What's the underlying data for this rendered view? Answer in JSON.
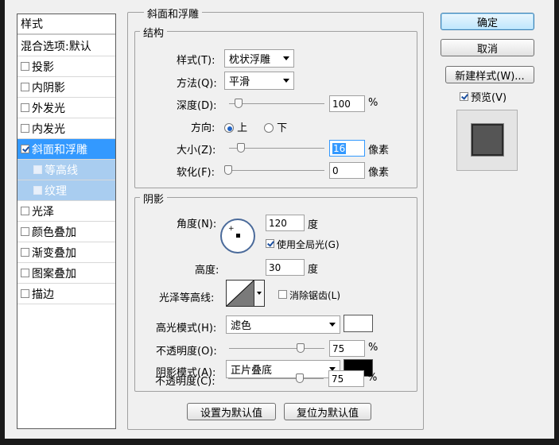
{
  "style_list": {
    "header": "样式",
    "items": [
      {
        "label": "混合选项:默认",
        "checkbox": false
      },
      {
        "label": "投影",
        "checkbox": true,
        "checked": false
      },
      {
        "label": "内阴影",
        "checkbox": true,
        "checked": false
      },
      {
        "label": "外发光",
        "checkbox": true,
        "checked": false
      },
      {
        "label": "内发光",
        "checkbox": true,
        "checked": false
      },
      {
        "label": "斜面和浮雕",
        "checkbox": true,
        "checked": true,
        "selected": true
      },
      {
        "label": "等高线",
        "checkbox": true,
        "checked": false,
        "sub": true
      },
      {
        "label": "纹理",
        "checkbox": true,
        "checked": false,
        "sub": true
      },
      {
        "label": "光泽",
        "checkbox": true,
        "checked": false
      },
      {
        "label": "颜色叠加",
        "checkbox": true,
        "checked": false
      },
      {
        "label": "渐变叠加",
        "checkbox": true,
        "checked": false
      },
      {
        "label": "图案叠加",
        "checkbox": true,
        "checked": false
      },
      {
        "label": "描边",
        "checkbox": true,
        "checked": false
      }
    ]
  },
  "bevel": {
    "group_title": "斜面和浮雕",
    "structure": {
      "title": "结构",
      "style_label": "样式(T):",
      "style_value": "枕状浮雕",
      "method_label": "方法(Q):",
      "method_value": "平滑",
      "depth_label": "深度(D):",
      "depth_value": "100",
      "depth_unit": "%",
      "depth_level": 0.1,
      "direction_label": "方向:",
      "direction_up": "上",
      "direction_down": "下",
      "size_label": "大小(Z):",
      "size_value": "16",
      "size_unit": "像素",
      "soften_label": "软化(F):",
      "soften_value": "0",
      "soften_unit": "像素"
    },
    "shading": {
      "title": "阴影",
      "angle_label": "角度(N):",
      "angle_value": "120",
      "angle_unit": "度",
      "global_light_label": "使用全局光(G)",
      "global_light_checked": true,
      "altitude_label": "高度:",
      "altitude_value": "30",
      "altitude_unit": "度",
      "gloss_label": "光泽等高线:",
      "antialias_label": "消除锯齿(L)",
      "antialias_checked": false,
      "highlight_mode_label": "高光模式(H):",
      "highlight_mode_value": "滤色",
      "highlight_color": "#ffffff",
      "highlight_opacity_label": "不透明度(O):",
      "highlight_opacity_value": "75",
      "shadow_mode_label": "阴影模式(A):",
      "shadow_mode_value": "正片叠底",
      "shadow_color": "#000000",
      "shadow_opacity_label": "不透明度(C):",
      "shadow_opacity_value": "75",
      "percent": "%"
    },
    "make_default": "设置为默认值",
    "reset_default": "复位为默认值"
  },
  "buttons": {
    "ok": "确定",
    "cancel": "取消",
    "new_style": "新建样式(W)...",
    "preview_label": "预览(V)",
    "preview_checked": true
  }
}
